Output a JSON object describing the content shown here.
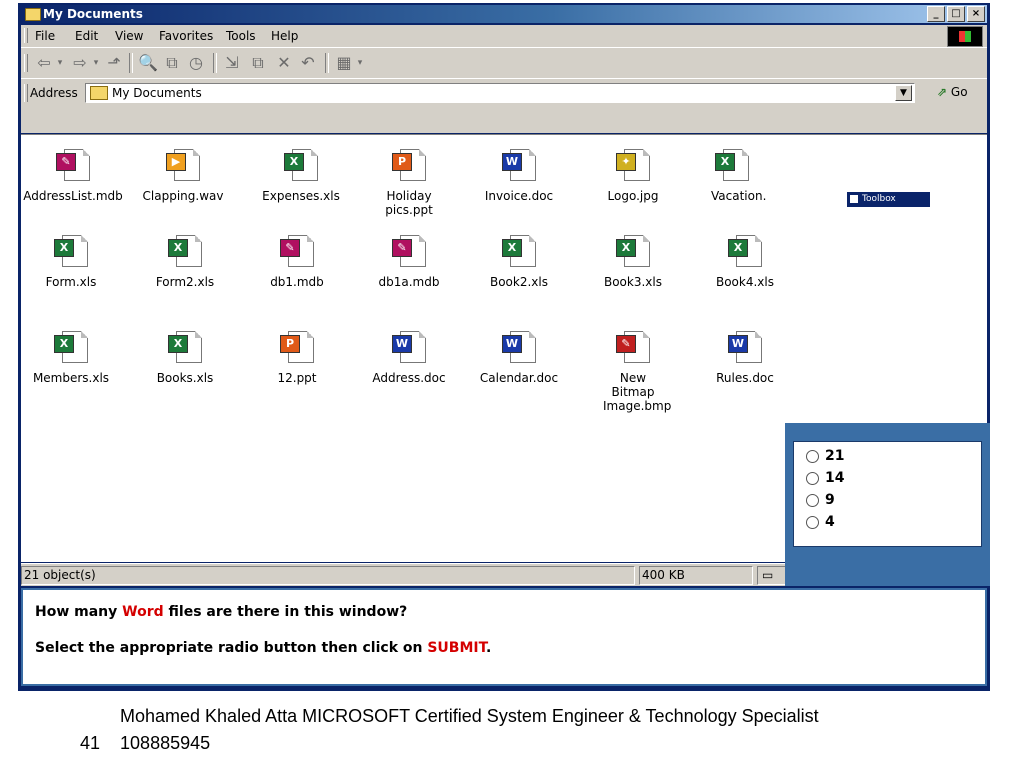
{
  "window": {
    "title": "My Documents"
  },
  "menu": [
    "File",
    "Edit",
    "View",
    "Favorites",
    "Tools",
    "Help"
  ],
  "toolbar": {
    "icons": [
      "back-icon",
      "forward-icon",
      "up-folder-icon",
      "search-icon",
      "folders-icon",
      "history-icon",
      "move-to-icon",
      "copy-to-icon",
      "delete-icon",
      "undo-icon",
      "views-icon"
    ]
  },
  "address": {
    "label": "Address",
    "value": "My Documents",
    "go_label": "Go"
  },
  "files": [
    {
      "name": "AddressList.mdb",
      "type": "mdb",
      "badge": "✎",
      "color": "#b01060"
    },
    {
      "name": "Clapping.wav",
      "type": "wav",
      "badge": "▶",
      "color": "#f0a020"
    },
    {
      "name": "Expenses.xls",
      "type": "xls",
      "badge": "X",
      "color": "#1d7a3a"
    },
    {
      "name": "Holiday pics.ppt",
      "type": "ppt",
      "badge": "P",
      "color": "#e05a18"
    },
    {
      "name": "Invoice.doc",
      "type": "doc",
      "badge": "W",
      "color": "#1a3aa8"
    },
    {
      "name": "Logo.jpg",
      "type": "jpg",
      "badge": "✦",
      "color": "#d0b020"
    },
    {
      "name": "Vacation.",
      "type": "xls",
      "badge": "X",
      "color": "#1d7a3a"
    },
    {
      "name": "Form.xls",
      "type": "xls",
      "badge": "X",
      "color": "#1d7a3a"
    },
    {
      "name": "Form2.xls",
      "type": "xls",
      "badge": "X",
      "color": "#1d7a3a"
    },
    {
      "name": "db1.mdb",
      "type": "mdb",
      "badge": "✎",
      "color": "#b01060"
    },
    {
      "name": "db1a.mdb",
      "type": "mdb",
      "badge": "✎",
      "color": "#b01060"
    },
    {
      "name": "Book2.xls",
      "type": "xls",
      "badge": "X",
      "color": "#1d7a3a"
    },
    {
      "name": "Book3.xls",
      "type": "xls",
      "badge": "X",
      "color": "#1d7a3a"
    },
    {
      "name": "Book4.xls",
      "type": "xls",
      "badge": "X",
      "color": "#1d7a3a"
    },
    {
      "name": "Members.xls",
      "type": "xls",
      "badge": "X",
      "color": "#1d7a3a"
    },
    {
      "name": "Books.xls",
      "type": "xls",
      "badge": "X",
      "color": "#1d7a3a"
    },
    {
      "name": "12.ppt",
      "type": "ppt",
      "badge": "P",
      "color": "#e05a18"
    },
    {
      "name": "Address.doc",
      "type": "doc",
      "badge": "W",
      "color": "#1a3aa8"
    },
    {
      "name": "Calendar.doc",
      "type": "doc",
      "badge": "W",
      "color": "#1a3aa8"
    },
    {
      "name": "New Bitmap Image.bmp",
      "type": "bmp",
      "badge": "✎",
      "color": "#c02020"
    },
    {
      "name": "Rules.doc",
      "type": "doc",
      "badge": "W",
      "color": "#1a3aa8"
    }
  ],
  "status": {
    "objects": "21 object(s)",
    "size": "400 KB"
  },
  "toolbox_label": "Toolbox",
  "question": {
    "line1_pre": "How many ",
    "line1_red": "Word",
    "line1_post": " files are there in this window?",
    "line2_pre": "Select the appropriate radio button then click on ",
    "line2_red": "SUBMIT",
    "line2_post": "."
  },
  "answers": [
    "21",
    "14",
    "9",
    "4"
  ],
  "footer": {
    "line1": "Mohamed Khaled Atta MICROSOFT Certified System Engineer & Technology Specialist",
    "page": "41",
    "phone": "108885945"
  }
}
